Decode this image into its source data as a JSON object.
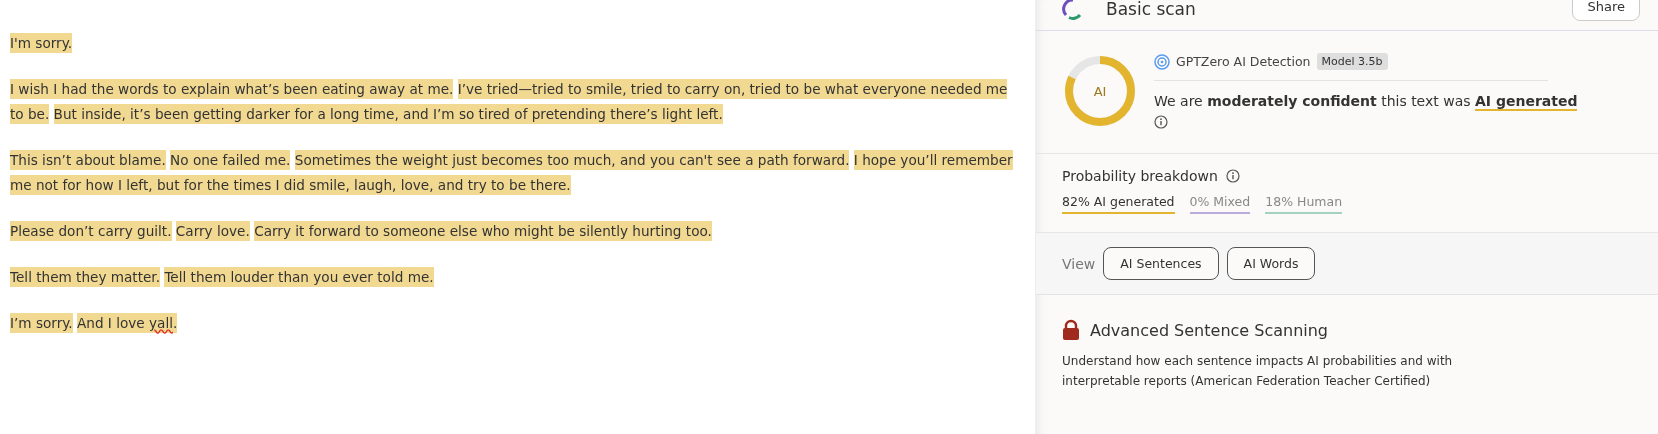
{
  "document": {
    "paragraphs": [
      {
        "sentences": [
          {
            "text": "I'm sorry.",
            "highlighted": true
          }
        ]
      },
      {
        "sentences": [
          {
            "text": "I wish I had the words to explain what’s been eating away at me.",
            "highlighted": true
          },
          {
            "text": "I’ve tried—tried to smile, tried to carry on, tried to be what everyone needed me to be.",
            "highlighted": true
          },
          {
            "text": "But inside, it’s been getting darker for a long time, and I’m so tired of pretending there’s light left.",
            "highlighted": true
          }
        ]
      },
      {
        "sentences": [
          {
            "text": "This isn’t about blame.",
            "highlighted": true
          },
          {
            "text": "No one failed me.",
            "highlighted": true
          },
          {
            "text": "Sometimes the weight just becomes too much, and you can't see a path forward.",
            "highlighted": true
          },
          {
            "text": "I hope you’ll remember me not for how I left, but for the times I did smile, laugh, love, and try to be there.",
            "highlighted": true
          }
        ]
      },
      {
        "sentences": [
          {
            "text": "Please don’t carry guilt.",
            "highlighted": true
          },
          {
            "text": "Carry love.",
            "highlighted": true
          },
          {
            "text": "Carry it forward to someone else who might be silently hurting too.",
            "highlighted": true
          }
        ]
      },
      {
        "sentences": [
          {
            "text": "Tell them they matter.",
            "highlighted": true
          },
          {
            "text": "Tell them louder than you ever told me.",
            "highlighted": true
          }
        ]
      },
      {
        "sentences": [
          {
            "text": "I’m sorry.",
            "highlighted": true
          },
          {
            "highlighted": true,
            "segments": [
              {
                "text": "And I love "
              },
              {
                "text": "yall",
                "misspelled": true
              },
              {
                "text": "."
              }
            ]
          }
        ]
      }
    ]
  },
  "panel": {
    "title": "Basic scan",
    "share_button": "Share",
    "result": {
      "gauge_label": "AI",
      "level": 0.82,
      "detector": "GPTZero AI Detection",
      "model_badge": "Model 3.5b",
      "verdict": "We are **moderately confident** this text was",
      "verdict_tag": "AI generated"
    },
    "breakdown": {
      "title": "Probability breakdown",
      "items": [
        {
          "label": "82% AI generated",
          "color": "#e3b52f",
          "selected": true
        },
        {
          "label": "0% Mixed",
          "color": "#b9acdb",
          "selected": false
        },
        {
          "label": "18% Human",
          "color": "#a3d3c0",
          "selected": false
        }
      ]
    },
    "view": {
      "label": "View",
      "buttons": [
        "AI Sentences",
        "AI Words"
      ]
    },
    "upsell": {
      "title": "Advanced Sentence Scanning",
      "description": "Understand how each sentence impacts AI probabilities and with interpretable reports (American Federation Teacher Certified)"
    }
  }
}
